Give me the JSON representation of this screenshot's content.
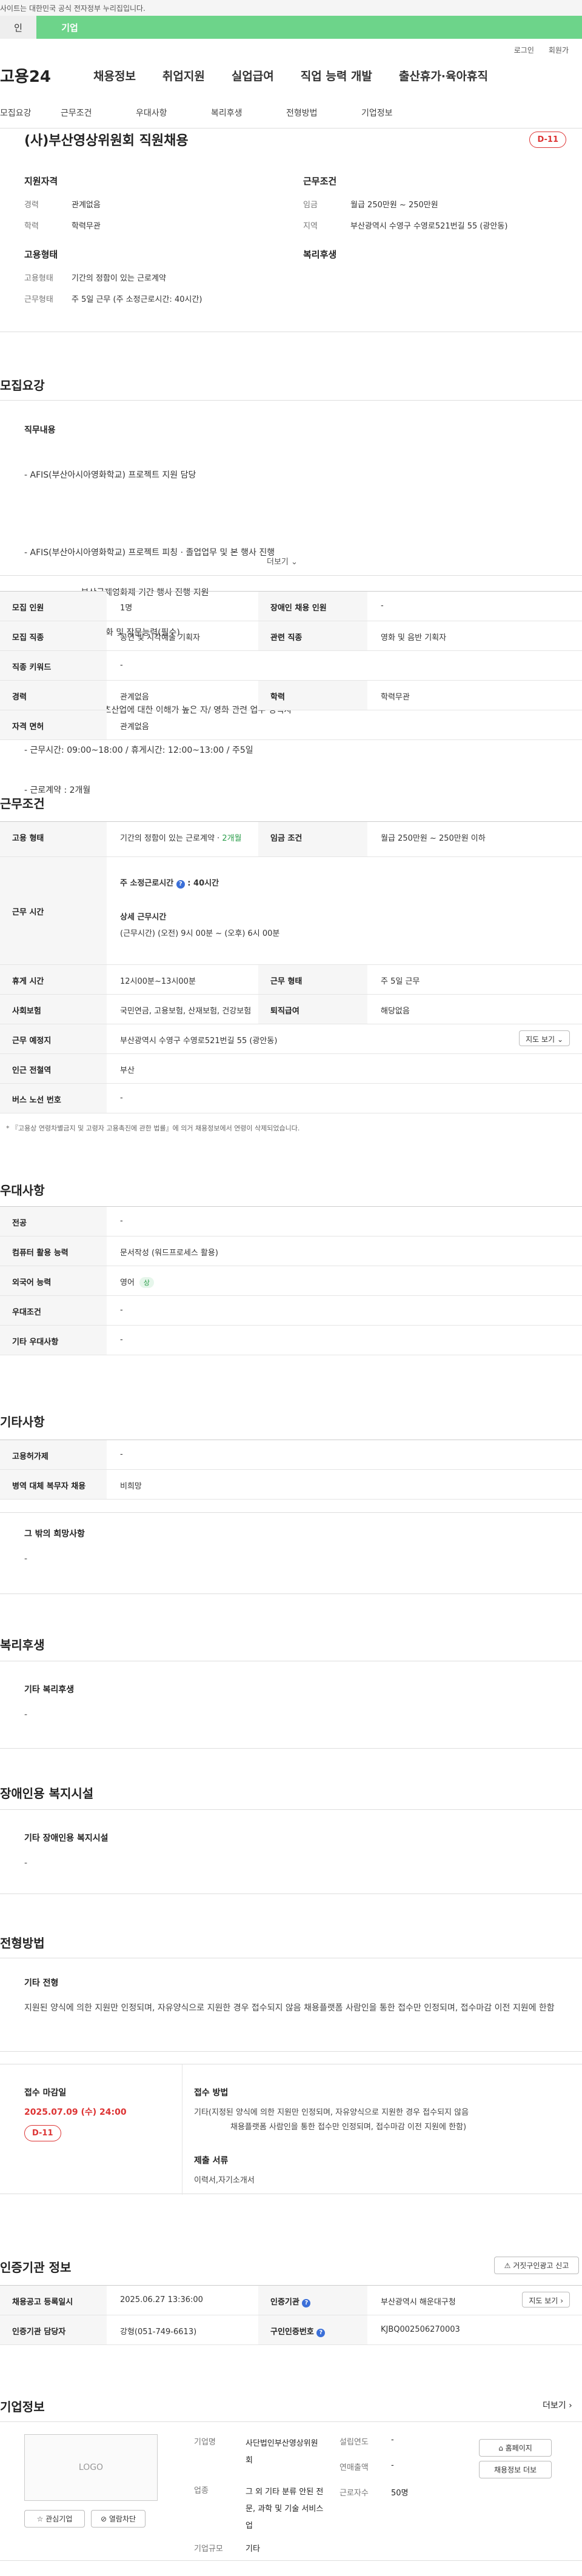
{
  "gov_bar": {
    "text": "사이트는 대한민국 공식 전자정부 누리집입니다."
  },
  "top_tabs": {
    "tab1": "인",
    "tab2": "기업"
  },
  "util": {
    "login": "로그인",
    "join": "회원가"
  },
  "gnb": {
    "logo": "고용24",
    "items": [
      "채용정보",
      "취업지원",
      "실업급여",
      "직업 능력 개발",
      "출산휴가·육아휴직"
    ]
  },
  "lnb": {
    "items": [
      "모집요강",
      "근무조건",
      "우대사항",
      "복리후생",
      "전형방법",
      "기업정보"
    ]
  },
  "header": {
    "title": "(사)부산영상위원회 직원채용",
    "dday": "D-11"
  },
  "summary": {
    "qual_title": "지원자격",
    "qual": [
      {
        "k": "경력",
        "v": "관계없음"
      },
      {
        "k": "학력",
        "v": "학력무관"
      }
    ],
    "emp_title": "고용형태",
    "emp": [
      {
        "k": "고용형태",
        "v": "기간의 정함이 있는 근로계약"
      },
      {
        "k": "근무형태",
        "v": "주 5일 근무 (주 소정근로시간: 40시간)"
      }
    ],
    "cond_title": "근무조건",
    "cond": [
      {
        "k": "임금",
        "v": "월급 250만원 ~ 250만원"
      },
      {
        "k": "지역",
        "v": "부산광역시 수영구 수영로521번길 55 (광안동)"
      }
    ],
    "welfare_title": "복리후생"
  },
  "recruit": {
    "title": "모집요강",
    "duty_label": "직무내용",
    "duty_lines": [
      "- AFIS(부산아시아영화학교) 프로젝트 지원 담당",
      "",
      "- AFIS(부산아시아영화학교) 프로젝트 피칭 · 졸업업무 및 본 행사 진행",
      "                     부산국제영화제 기간 행사 진행 지원",
      "- ★ 중급이상의 영어회화 및 작문능력(필수)",
      "",
      "- 우대사항 : 영상 콘텐츠산업에 대한 이해가 높은 자/ 영화 관련 업무 경력자",
      "- 근무시간: 09:00~18:00 / 휴게시간: 12:00~13:00 / 주5일",
      "- 근로계약 : 2개월"
    ],
    "more": "더보기",
    "rows": {
      "count_k": "모집 인원",
      "count_v": "1명",
      "disabled_k": "장애인 채용 인원",
      "disabled_v": "-",
      "job_k": "모집 직종",
      "job_v": "공연 및 시각예술 기획자",
      "rel_k": "관련 직종",
      "rel_v": "영화 및 음반 기획자",
      "kw_k": "직종 키워드",
      "kw_v": "-",
      "career_k": "경력",
      "career_v": "관계없음",
      "edu_k": "학력",
      "edu_v": "학력무관",
      "lic_k": "자격 면허",
      "lic_v": "관계없음"
    }
  },
  "work": {
    "title": "근무조건",
    "type_k": "고용 형태",
    "type_v": "기간의 정함이 있는 근로계약",
    "type_period": "2개월",
    "wage_k": "임금 조건",
    "wage_v": "월급 250만원 ~ 250만원 이하",
    "hours_k": "근무 시간",
    "hours_total": "주 소정근로시간",
    "hours_total_v": "40시간",
    "hours_detail_label": "상세 근무시간",
    "hours_detail_v": "(근무시간) (오전) 9시 00분 ~ (오후) 6시 00분",
    "break_k": "휴게 시간",
    "break_v": "12시00분~13시00분",
    "shift_k": "근무 형태",
    "shift_v": "주 5일 근무",
    "ins_k": "사회보험",
    "ins_v": "국민연금, 고용보험, 산재보험, 건강보험",
    "ret_k": "퇴직급여",
    "ret_v": "해당없음",
    "loc_k": "근무 예정지",
    "loc_v": "부산광역시 수영구 수영로521번길 55 (광안동)",
    "map_btn": "지도 보기",
    "sub_k": "인근 전철역",
    "sub_v": "부산",
    "bus_k": "버스 노선 번호",
    "bus_v": "-",
    "note": "* 『고용상 연령차별금지 및 고령자 고용촉진에 관한 법률』에 의거 채용정보에서 연령이 삭제되었습니다."
  },
  "pref": {
    "title": "우대사항",
    "major_k": "전공",
    "major_v": "-",
    "pc_k": "컴퓨터 활용 능력",
    "pc_v": "문서작성 (워드프로세스 활용)",
    "lang_k": "외국어 능력",
    "lang_v": "영어",
    "lang_badge": "상",
    "cond_k": "우대조건",
    "cond_v": "-",
    "etc_k": "기타 우대사항",
    "etc_v": "-"
  },
  "misc": {
    "title": "기타사항",
    "emp_k": "고용허가제",
    "emp_v": "-",
    "mil_k": "병역 대체 복무자 채용",
    "mil_v": "비희망",
    "hope_title": "그 밖의 희망사항",
    "hope_v": "-"
  },
  "welfare": {
    "title": "복리후생",
    "box_title": "기타 복리후생",
    "box_v": "-"
  },
  "disab": {
    "title": "장애인용 복지시설",
    "box_title": "기타 장애인용 복지시설",
    "box_v": "-"
  },
  "process": {
    "title": "전형방법",
    "box_title": "기타 전형",
    "box_v": "지원된 양식에 의한 지원만 인정되며, 자유양식으로 지원한 경우 접수되지 않음 채용플랫폼 사람인을 통한 접수만 인정되며, 접수마감 이전 지원에 한함",
    "deadline_label": "접수 마감일",
    "deadline_v": "2025.07.09 (수) 24:00",
    "deadline_dday": "D-11",
    "method_label": "접수 방법",
    "method_v1": "기타(지정된 양식에 의한 지원만 인정되며, 자유양식으로 지원한 경우 접수되지 않음",
    "method_v2": "채용플랫폼 사람인을 통한 접수만 인정되며, 접수마감 이전 지원에 한함)",
    "docs_label": "제출 서류",
    "docs_v": "이력서,자기소개서"
  },
  "agency": {
    "title": "인증기관 정보",
    "report_btn": "거짓구인광고 신고",
    "reg_k": "채용공고 등록일시",
    "reg_v": "2025.06.27 13:36:00",
    "agency_k": "인증기관",
    "agency_v": "부산광역시 해운대구청",
    "map_btn": "지도 보기",
    "mgr_k": "인증기관 담당자",
    "mgr_v": "강형(051-749-6613)",
    "num_k": "구인인증번호",
    "num_v": "KJBQ002506270003"
  },
  "company": {
    "title": "기업정보",
    "more": "더보기",
    "logo": "LOGO",
    "fav_btn": "관심기업",
    "block_btn": "열람차단",
    "name_k": "기업명",
    "name_v": "사단법인부산영상위원회",
    "biz_k": "업종",
    "biz_v": "그 외 기타 분류 안된 전문, 과학 및 기술 서비스업",
    "size_k": "기업규모",
    "size_v": "기타",
    "year_k": "설립연도",
    "year_v": "-",
    "sales_k": "연매출액",
    "sales_v": "-",
    "emp_k": "근로자수",
    "emp_v": "50명",
    "home_btn": "홈페이지",
    "jobs_btn": "채용정보 더보"
  }
}
